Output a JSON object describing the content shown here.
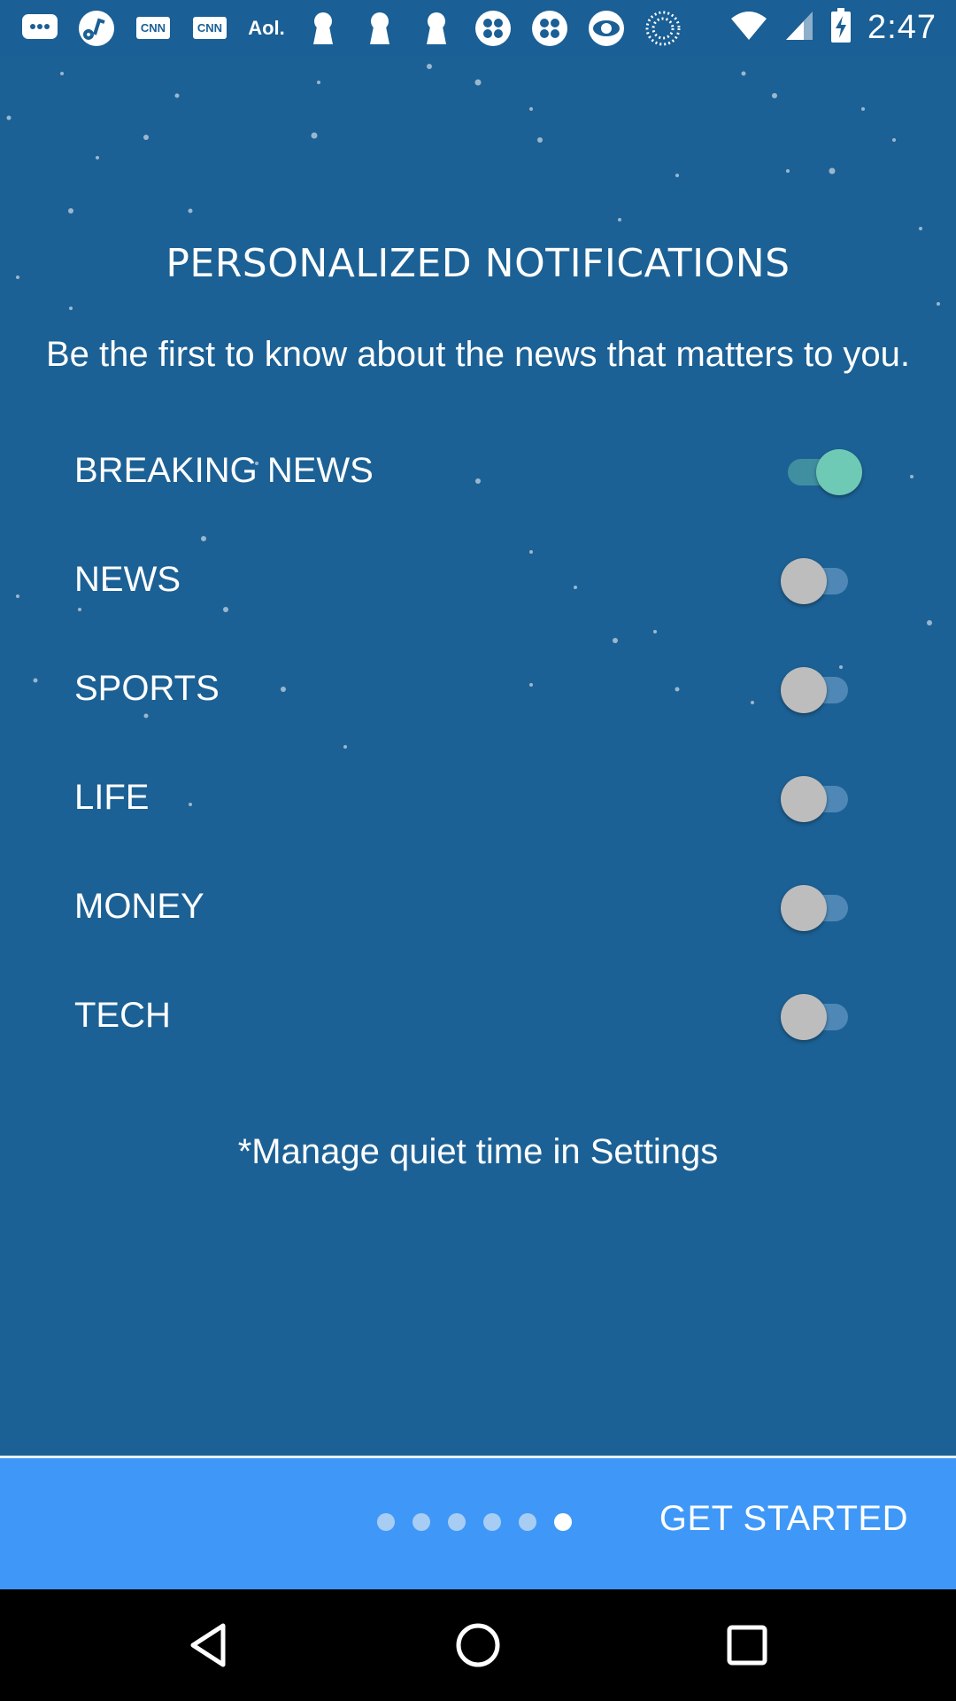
{
  "status_bar": {
    "time": "2:47",
    "left_icons": [
      "chat-bubble-icon",
      "music-note-icon",
      "cnn-icon",
      "cnn-icon",
      "aol-icon",
      "keyhole-icon",
      "keyhole-icon",
      "keyhole-icon",
      "clover-icon",
      "clover-icon",
      "cbs-eye-icon",
      "dotted-circle-icon"
    ],
    "right_icons": [
      "wifi-icon",
      "signal-icon",
      "battery-charging-icon"
    ],
    "cnn_text": "CNN",
    "aol_text": "Aol."
  },
  "main": {
    "title": "PERSONALIZED NOTIFICATIONS",
    "subtitle": "Be the first to know about the news that matters to you.",
    "categories": [
      {
        "label": "BREAKING NEWS",
        "enabled": true
      },
      {
        "label": "NEWS",
        "enabled": false
      },
      {
        "label": "SPORTS",
        "enabled": false
      },
      {
        "label": "LIFE",
        "enabled": false
      },
      {
        "label": "MONEY",
        "enabled": false
      },
      {
        "label": "TECH",
        "enabled": false
      }
    ],
    "note": "*Manage quiet time in Settings"
  },
  "footer": {
    "page_count": 6,
    "active_page": 6,
    "get_started_label": "GET STARTED"
  },
  "nav_bar": {
    "buttons": [
      "back-icon",
      "home-icon",
      "recents-icon"
    ]
  },
  "colors": {
    "background": "#1c6195",
    "footer": "#3f98f7",
    "toggle_on": "#6fcab5",
    "toggle_off": "#bdbdbd"
  }
}
